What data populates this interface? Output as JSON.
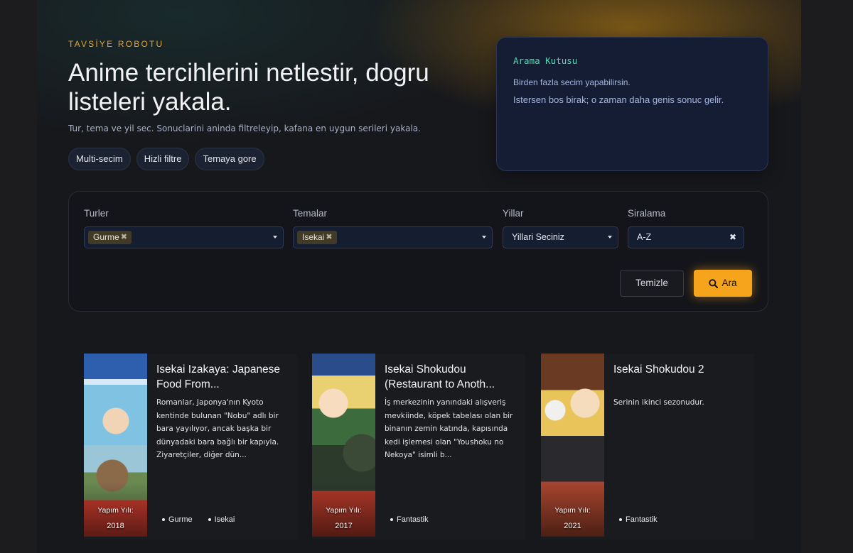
{
  "hero": {
    "eyebrow": "TAVSİYE ROBOTU",
    "title": "Anime tercihlerini netlestir, dogru listeleri yakala.",
    "subtitle": "Tur, tema ve yil sec. Sonuclarini aninda filtreleyip, kafana en uygun serileri yakala.",
    "chips": [
      "Multi-secim",
      "Hizli filtre",
      "Temaya gore"
    ]
  },
  "search_box": {
    "title": "Arama Kutusu",
    "line1": "Birden fazla secim yapabilirsin.",
    "line2": "Istersen bos birak; o zaman daha genis sonuc gelir."
  },
  "filters": {
    "genres": {
      "label": "Turler",
      "selected": "Gurme"
    },
    "themes": {
      "label": "Temalar",
      "selected": "Isekai"
    },
    "years": {
      "label": "Yillar",
      "placeholder": "Yillari Seciniz"
    },
    "sort": {
      "label": "Siralama",
      "value": "A-Z"
    },
    "clear_label": "Temizle",
    "search_label": "Ara"
  },
  "results": [
    {
      "title": "Isekai Izakaya: Japanese Food From...",
      "description": "Romanlar, Japonya'nın Kyoto kentinde bulunan \"Nobu\" adlı bir bara yayılıyor, ancak başka bir dünyadaki bara bağlı bir kapıyla. Ziyaretçiler, diğer dün...",
      "year_label": "Yapım Yılı:",
      "year": "2018",
      "tags": [
        "Gurme",
        "Isekai"
      ]
    },
    {
      "title": "Isekai Shokudou (Restaurant to Anoth...",
      "description": "İş merkezinin yanındaki alışveriş mevkiinde, köpek tabelası olan bir binanın zemin katında, kapısında kedi işlemesi olan \"Youshoku no Nekoya\" isimli b...",
      "year_label": "Yapım Yılı:",
      "year": "2017",
      "tags": [
        "Fantastik"
      ]
    },
    {
      "title": "Isekai Shokudou 2",
      "description": "Serinin ikinci sezonudur.",
      "year_label": "Yapım Yılı:",
      "year": "2021",
      "tags": [
        "Fantastik"
      ]
    }
  ],
  "colors": {
    "accent": "#f7a41d",
    "eyebrow": "#e4a230",
    "mono_title": "#58d6b3",
    "panel_bg": "#141d33"
  },
  "icons": [
    "remove-tag-icon",
    "chevron-down-icon",
    "clear-icon",
    "search-icon",
    "bullet-icon"
  ]
}
